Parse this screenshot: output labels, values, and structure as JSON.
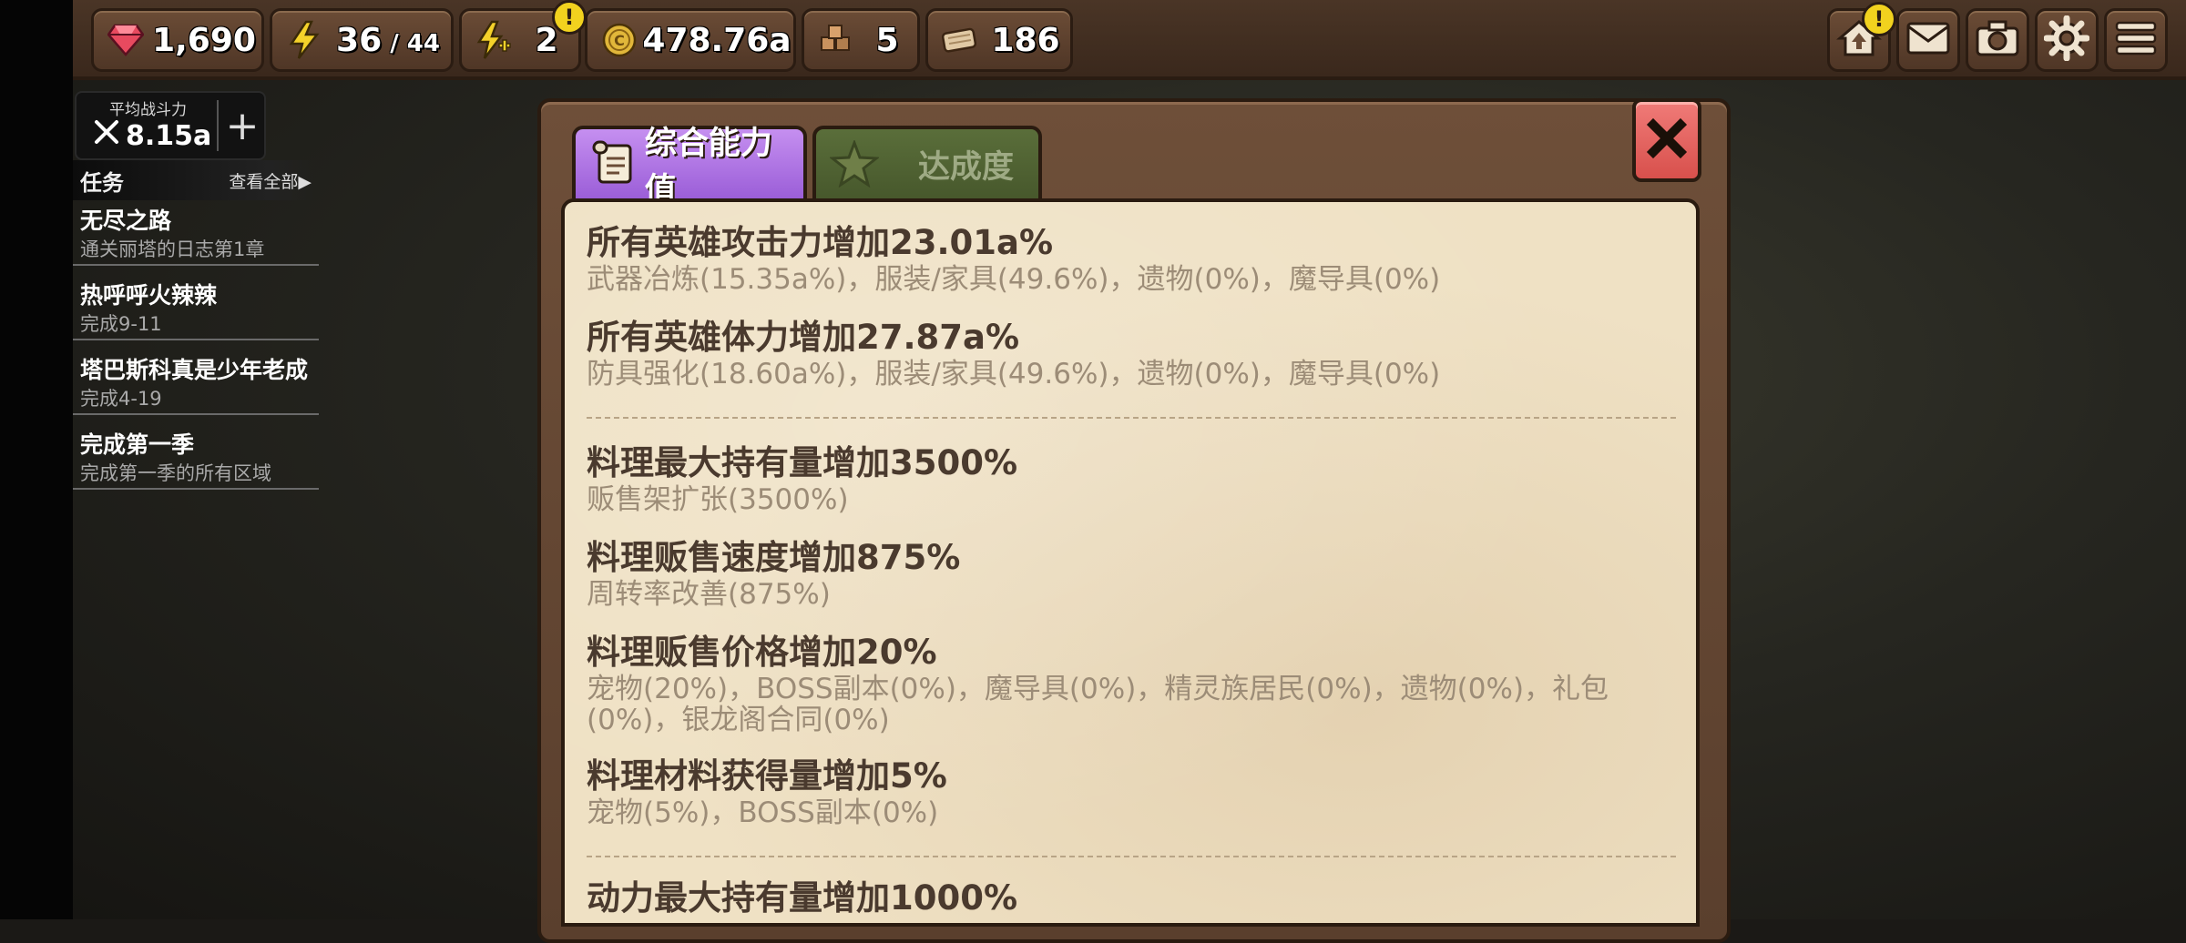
{
  "resources": {
    "gems": "1,690",
    "energy_current": "36",
    "energy_sep": " / ",
    "energy_max": "44",
    "boost": "2",
    "gold": "478.76a",
    "blocks": "5",
    "wood": "186",
    "alert_mark": "!"
  },
  "colors": {
    "tab_active": "#b47ce6",
    "tab_inactive": "#4f6232",
    "close": "#e25f5b",
    "paper": "#efe1c4",
    "alert": "#f2d21e"
  },
  "icons": [
    "ruby-icon",
    "lightning-icon",
    "boost-icon",
    "coin-icon",
    "blocks-icon",
    "wood-icon",
    "home-upgrade-icon",
    "mail-icon",
    "camera-icon",
    "settings-icon",
    "menu-icon",
    "swords-icon",
    "plus-icon",
    "scroll-icon",
    "star-icon",
    "close-icon"
  ],
  "power": {
    "label": "平均战斗力",
    "value": "8.15a",
    "plus": "+"
  },
  "quests": {
    "title": "任务",
    "view_all": "查看全部▶",
    "items": [
      {
        "name": "无尽之路",
        "desc": "通关丽塔的日志第1章"
      },
      {
        "name": "热呼呼火辣辣",
        "desc": "完成9-11"
      },
      {
        "name": "塔巴斯科真是少年老成",
        "desc": "完成4-19"
      },
      {
        "name": "完成第一季",
        "desc": "完成第一季的所有区域"
      }
    ]
  },
  "tabs": {
    "stats": "综合能力值",
    "achievement": "达成度"
  },
  "entries": [
    {
      "title": "所有英雄攻击力增加23.01a%",
      "detail": "武器冶炼(15.35a%)，服装/家具(49.6%)，遗物(0%)，魔导具(0%)"
    },
    {
      "title": "所有英雄体力增加27.87a%",
      "detail": "防具强化(18.60a%)，服装/家具(49.6%)，遗物(0%)，魔导具(0%)"
    },
    {
      "title": "料理最大持有量增加3500%",
      "detail": "贩售架扩张(3500%)"
    },
    {
      "title": "料理贩售速度增加875%",
      "detail": "周转率改善(875%)"
    },
    {
      "title": "料理贩售价格增加20%",
      "detail": "宠物(20%)，BOSS副本(0%)，魔导具(0%)，精灵族居民(0%)，遗物(0%)，礼包(0%)，银龙阁合同(0%)"
    },
    {
      "title": "料理材料获得量增加5%",
      "detail": "宠物(5%)，BOSS副本(0%)"
    },
    {
      "title": "动力最大持有量增加1000%",
      "detail": ""
    }
  ]
}
